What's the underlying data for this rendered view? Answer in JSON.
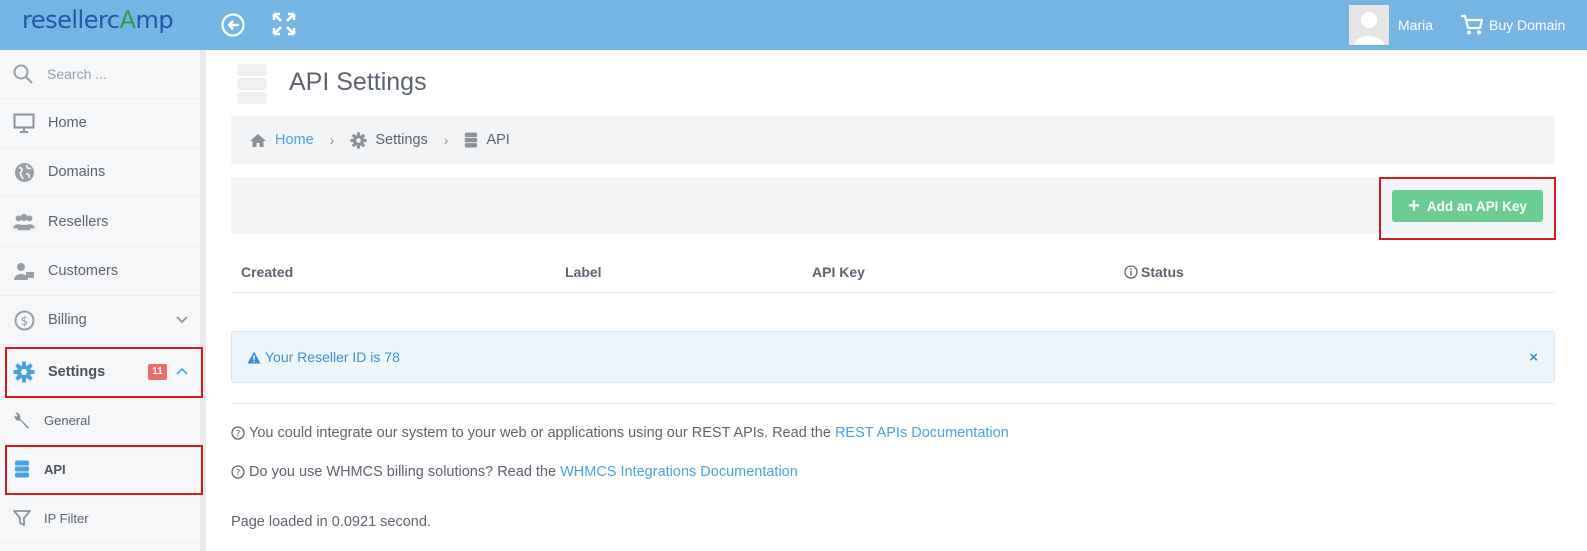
{
  "app": {
    "logo_text_1": "resellerc",
    "logo_text_a": "A",
    "logo_text_2": "mp"
  },
  "topbar": {
    "user_name": "Maria",
    "buy_label": "Buy Domain"
  },
  "sidebar": {
    "search_placeholder": "Search ...",
    "items": [
      {
        "label": "Home"
      },
      {
        "label": "Domains"
      },
      {
        "label": "Resellers"
      },
      {
        "label": "Customers"
      },
      {
        "label": "Billing"
      },
      {
        "label": "Settings",
        "badge": "11"
      }
    ],
    "subitems": [
      {
        "label": "General"
      },
      {
        "label": "API"
      },
      {
        "label": "IP Filter"
      }
    ]
  },
  "main": {
    "title": "API Settings",
    "breadcrumb": {
      "home": "Home",
      "settings": "Settings",
      "api": "API",
      "separator": "›"
    },
    "add_button": "Add an API Key",
    "columns": [
      "Created",
      "Label",
      "API Key",
      "Status"
    ],
    "alert": {
      "text": "Your Reseller ID is 78",
      "close": "×"
    },
    "info1": {
      "text": "You could integrate our system to your web or applications using our REST APIs. Read the",
      "link": "REST APIs Documentation"
    },
    "info2": {
      "text": "Do you use WHMCS billing solutions? Read the",
      "link": "WHMCS Integrations Documentation"
    },
    "footer": "Page loaded in 0.0921 second."
  },
  "colors": {
    "topbar": "#75b5e3",
    "accent_link": "#4aa3df",
    "success": "#6bcd92",
    "badge": "#ec6b6b",
    "highlight_box": "#d71920"
  }
}
